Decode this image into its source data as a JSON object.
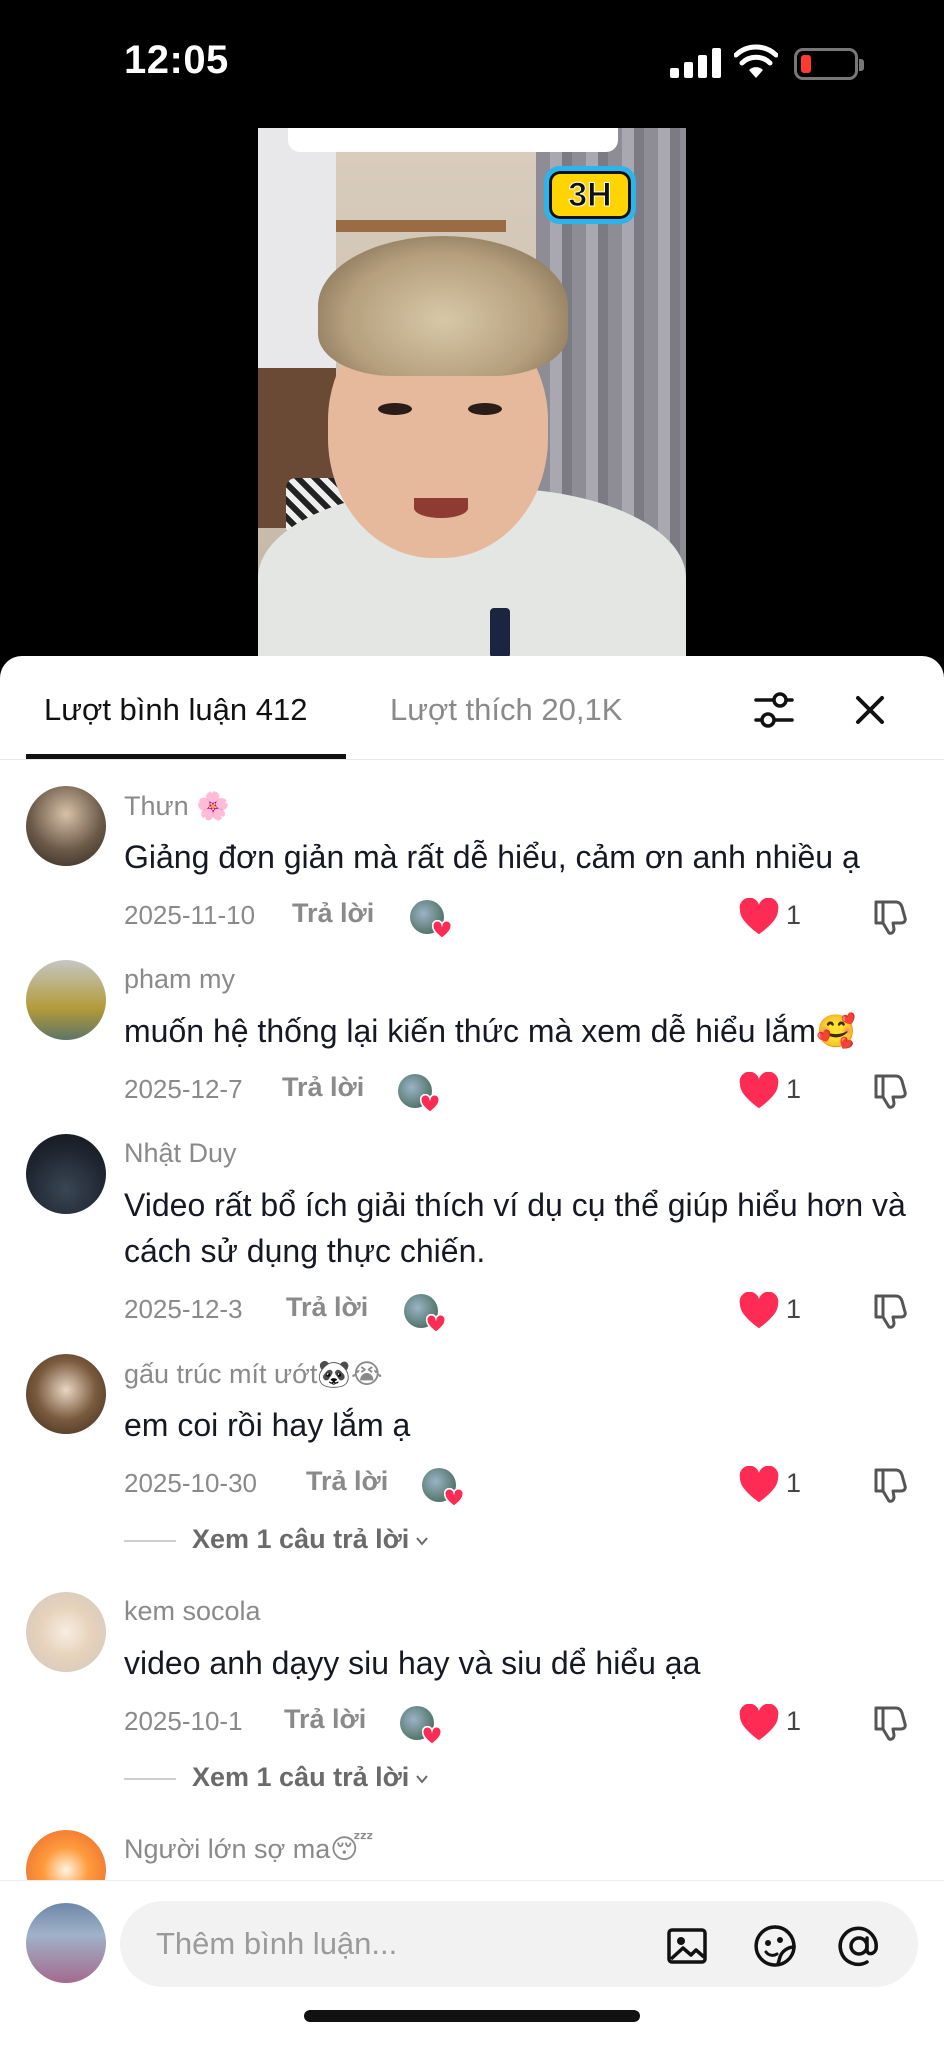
{
  "status_bar": {
    "time": "12:05"
  },
  "video": {
    "badge": "3H"
  },
  "tabs": {
    "comments": "Lượt bình luận 412",
    "likes": "Lượt thích 20,1K"
  },
  "comments": [
    {
      "user": "Thưn 🌸",
      "text": "Giảng đơn giản mà rất dễ hiểu, cảm ơn anh nhiều ạ",
      "date": "2025-11-10",
      "reply": "Trả lời",
      "likes": "1"
    },
    {
      "user": "pham my",
      "text": "muốn hệ thống lại kiến thức mà xem dễ hiểu lắm🥰",
      "date": "2025-12-7",
      "reply": "Trả lời",
      "likes": "1"
    },
    {
      "user": "Nhật Duy",
      "text": "Video rất bổ ích giải thích ví dụ cụ thể giúp hiểu hơn và cách sử dụng thực chiến.",
      "date": "2025-12-3",
      "reply": "Trả lời",
      "likes": "1"
    },
    {
      "user": "gấu trúc mít ướt🐼😭",
      "text": "em coi rồi hay lắm ạ",
      "date": "2025-10-30",
      "reply": "Trả lời",
      "likes": "1",
      "more": "Xem 1 câu trả lời"
    },
    {
      "user": "kem socola",
      "text": "video anh dạyy siu hay và siu dể hiểu ạa",
      "date": "2025-10-1",
      "reply": "Trả lời",
      "likes": "1",
      "more": "Xem 1 câu trả lời"
    },
    {
      "user": "Người lớn sợ ma😴"
    }
  ],
  "input": {
    "placeholder": "Thêm bình luận..."
  },
  "icons": {
    "filter": "filter-sliders-icon",
    "close": "close-icon",
    "heart": "heart-icon",
    "dislike": "thumb-down-icon",
    "image": "image-icon",
    "sticker": "sticker-icon",
    "mention": "at-icon"
  },
  "colors": {
    "heart": "#fe2c55",
    "battery_low": "#ff3b30"
  }
}
